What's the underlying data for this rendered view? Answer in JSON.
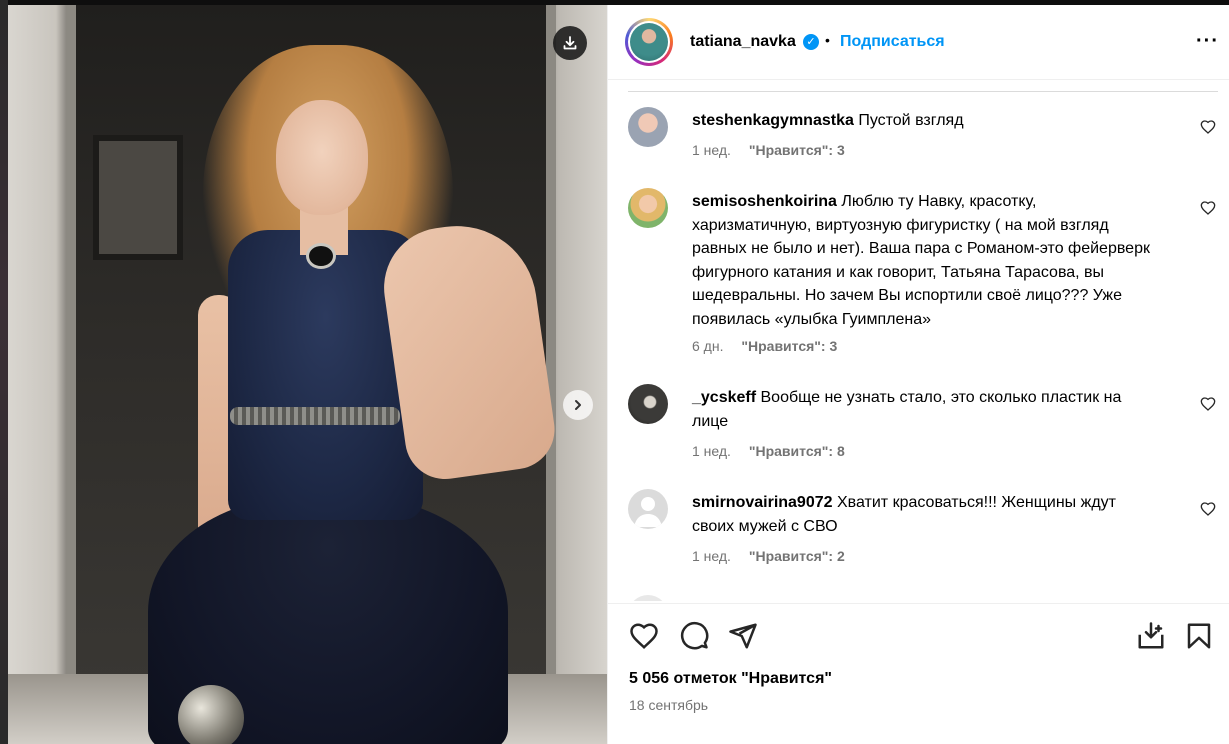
{
  "post": {
    "username": "tatiana_navka",
    "verified_icon": "verified-badge-icon",
    "separator": "•",
    "follow_label": "Подписаться",
    "more_label": "···"
  },
  "comments": [
    {
      "username": "steshenkagymnastka",
      "text": "Пустой взгляд",
      "age": "1 нед.",
      "likes": "\"Нравится\": 3"
    },
    {
      "username": "semisoshenkoirina",
      "text": "Люблю ту Навку, красотку, харизматичную, виртуозную фигуристку ( на мой взгляд равных не было и нет). Ваша пара с Романом-это фейерверк фигурного катания и как говорит, Татьяна Тарасова, вы шедевральны. Но зачем Вы испортили своё лицо??? Уже появилась «улыбка Гуимплена»",
      "age": "6 дн.",
      "likes": "\"Нравится\": 3"
    },
    {
      "username": "_ycskeff",
      "text": "Вообще не узнать стало, это сколько пластик на лице",
      "age": "1 нед.",
      "likes": "\"Нравится\": 8"
    },
    {
      "username": "smirnovairina9072",
      "text": "Хватит красоваться!!! Женщины ждут своих мужей с СВО",
      "age": "1 нед.",
      "likes": "\"Нравится\": 2"
    }
  ],
  "footer": {
    "likes_count": "5 056 отметок \"Нравится\"",
    "date": "18 сентябрь"
  },
  "colors": {
    "accent": "#0095f6",
    "muted": "#737373"
  }
}
